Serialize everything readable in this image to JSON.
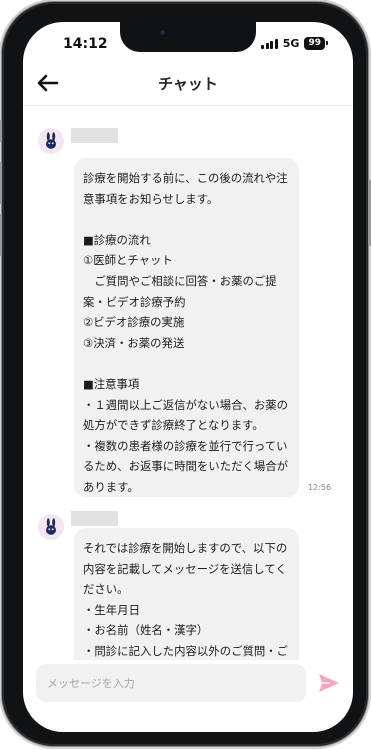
{
  "status_bar": {
    "time": "14:12",
    "network": "5G",
    "battery": "99"
  },
  "header": {
    "title": "チャット"
  },
  "messages": [
    {
      "text": "診療を開始する前に、この後の流れや注意事項をお知らせします。\n\n■診療の流れ\n①医師とチャット\n　ご質問やご相談に回答・お薬のご提案・ビデオ診療予約\n②ビデオ診療の実施\n③決済・お薬の発送\n\n■注意事項\n・１週間以上ご返信がない場合、お薬の処方ができず診療終了となります。\n・複数の患者様の診療を並行で行っているため、お返事に時間をいただく場合があります。",
      "time": "12:56"
    },
    {
      "text": "それでは診療を開始しますので、以下の内容を記載してメッセージを送信してください。\n・生年月日\n・お名前（姓名・漢字）\n・問診に記入した内容以外のご質問・ご相談事項",
      "time": ""
    }
  ],
  "input": {
    "placeholder": "メッセージを入力"
  },
  "colors": {
    "accent": "#f4a6c0",
    "avatar_bg": "#f3e6ee",
    "bubble_bg": "#f1f1f1",
    "avatar_icon": "#1f2a5a"
  },
  "icons": {
    "back": "arrow-left-icon",
    "send": "send-icon",
    "avatar": "rabbit-icon"
  }
}
